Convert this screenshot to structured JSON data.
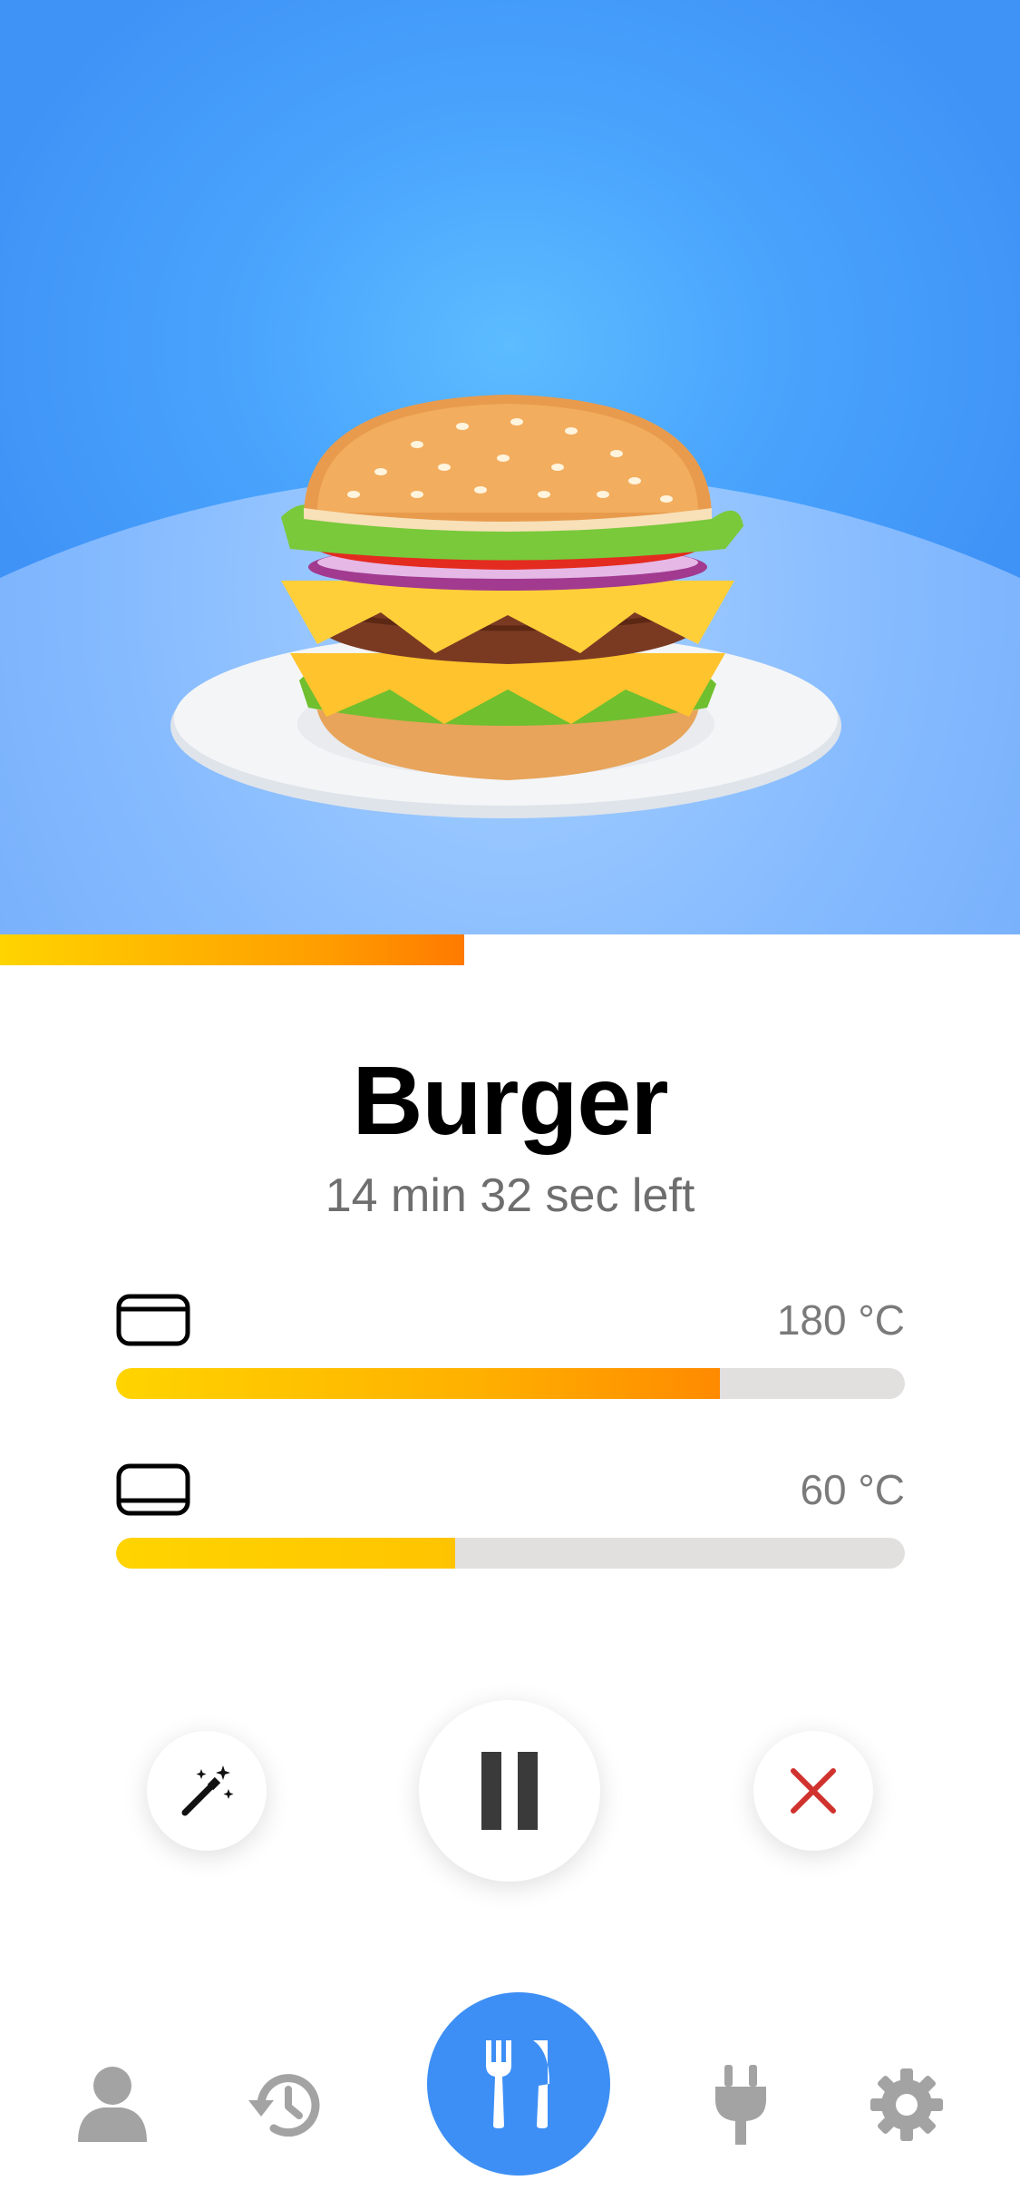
{
  "dish": {
    "name": "Burger",
    "time_left": "14 min 32 sec left",
    "progress": 0.455
  },
  "heating": [
    {
      "label": "top-heat",
      "temperature": "180 °C",
      "level": 0.765
    },
    {
      "label": "bottom-heat",
      "temperature": "60 °C",
      "level": 0.43
    }
  ],
  "controls": {
    "left": "magic-wand-icon",
    "center": "pause-icon",
    "right": "close-icon"
  },
  "colors": {
    "accent": "#3d8ff5",
    "progress_start": "#ffd400",
    "progress_end": "#ff7a00",
    "cancel": "#d0322d",
    "nav_inactive": "#a3a3a3",
    "track": "#e2dfdf"
  },
  "bottom_nav": [
    "profile-icon",
    "history-icon",
    "cutlery-icon",
    "plug-icon",
    "settings-gear-icon"
  ]
}
